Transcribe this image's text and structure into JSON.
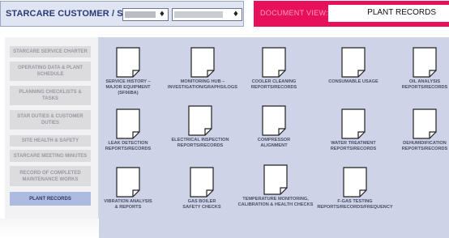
{
  "header": {
    "title": "STARCARE CUSTOMER / SITE:",
    "select1_arrow": "♦",
    "select2_arrow": "♦",
    "doc_view_label": "DOCUMENT VIEW:",
    "doc_view_value": "PLANT RECORDS"
  },
  "sidebar": {
    "items": [
      {
        "label": "STARCARE SERVICE CHARTER"
      },
      {
        "label": "OPERATING DATA & PLANT SCHEDULE"
      },
      {
        "label": "PLANNING CHECKLISTS & TASKS"
      },
      {
        "label": "STAR DUTIES & CUSTOMER DUTIES"
      },
      {
        "label": "SITE HEALTH & SAFETY"
      },
      {
        "label": "STARCARE MEETING MINUTES"
      },
      {
        "label": "RECORD OF COMPLETED MAINTENANCE WORKS"
      },
      {
        "label": "PLANT RECORDS"
      }
    ]
  },
  "documents": [
    {
      "label": "SERVICE HISTORY –\nMAJOR EQUIPMENT\n(SF06BA)"
    },
    {
      "label": "MONITORING HUB –\nINVESTIGATION/GRAPHS/LOGS"
    },
    {
      "label": "COOLER CLEANING\nREPORTS/RECORDS"
    },
    {
      "label": "CONSUMABLE USAGE"
    },
    {
      "label": "OIL ANALYSIS\nREPORTS/RECORDS"
    },
    {
      "label": "LEAK DETECTION\nREPORTS/RECORDS"
    },
    {
      "label": "ELECTRICAL INSPECTION\nREPORTS/RECORDS"
    },
    {
      "label": "COMPRESSOR\nALIGNMENT"
    },
    {
      "label": "WATER TREATMENT\nREPORTS/RECORDS"
    },
    {
      "label": "DEHUMIDIFICATION\nREPORTS/RECORDS"
    },
    {
      "label": "VIBRATION ANALYSIS\n& REPORTS"
    },
    {
      "label": "GAS BOILER\nSAFETY CHECKS"
    },
    {
      "label": "TEMPERATURE MONITORING,\nCALIBRATION & HEALTH CHECKS"
    },
    {
      "label": "F-GAS TESTING\nREPORTS/RECORDS/FREQUENCY"
    }
  ]
}
